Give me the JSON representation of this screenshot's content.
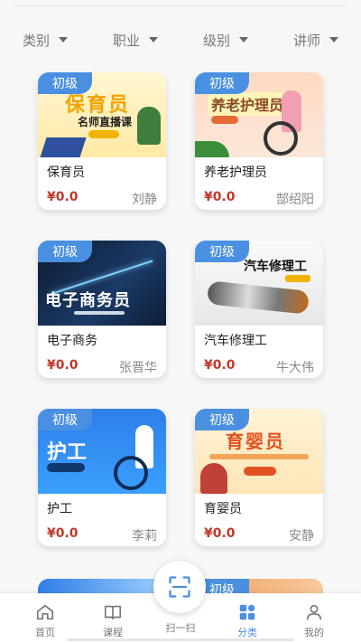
{
  "filters": [
    {
      "label": "类别"
    },
    {
      "label": "职业"
    },
    {
      "label": "级别"
    },
    {
      "label": "讲师"
    }
  ],
  "courses": [
    {
      "level": "初级",
      "title": "保育员",
      "price": "¥0.0",
      "lecturer": "刘静",
      "thumb": {
        "heading": "保育员",
        "subheading": "名师直播课"
      }
    },
    {
      "level": "初级",
      "title": "养老护理员",
      "price": "¥0.0",
      "lecturer": "郜绍阳",
      "thumb": {
        "heading": "养老护理员"
      }
    },
    {
      "level": "初级",
      "title": "电子商务",
      "price": "¥0.0",
      "lecturer": "张晋华",
      "thumb": {
        "heading": "电子商务员"
      }
    },
    {
      "level": "初级",
      "title": "汽车修理工",
      "price": "¥0.0",
      "lecturer": "牛大伟",
      "thumb": {
        "heading": "汽车修理工"
      }
    },
    {
      "level": "初级",
      "title": "护工",
      "price": "¥0.0",
      "lecturer": "李莉",
      "thumb": {
        "heading": "护工"
      }
    },
    {
      "level": "初级",
      "title": "育婴员",
      "price": "¥0.0",
      "lecturer": "安静",
      "thumb": {
        "heading": "育婴员"
      }
    }
  ],
  "peek": {
    "level": "初级"
  },
  "tabbar": {
    "home": "首页",
    "courses": "课程",
    "scan": "扫一扫",
    "category": "分类",
    "mine": "我的",
    "active": "分类",
    "active_color": "#4a8fe0"
  },
  "icons": {
    "home": "home-icon",
    "courses": "book-icon",
    "scan": "scan-icon",
    "category": "category-grid-icon",
    "mine": "person-icon",
    "filter_caret": "caret-down-icon"
  },
  "colors": {
    "badge": "#4a90e2",
    "price": "#c0392b"
  }
}
